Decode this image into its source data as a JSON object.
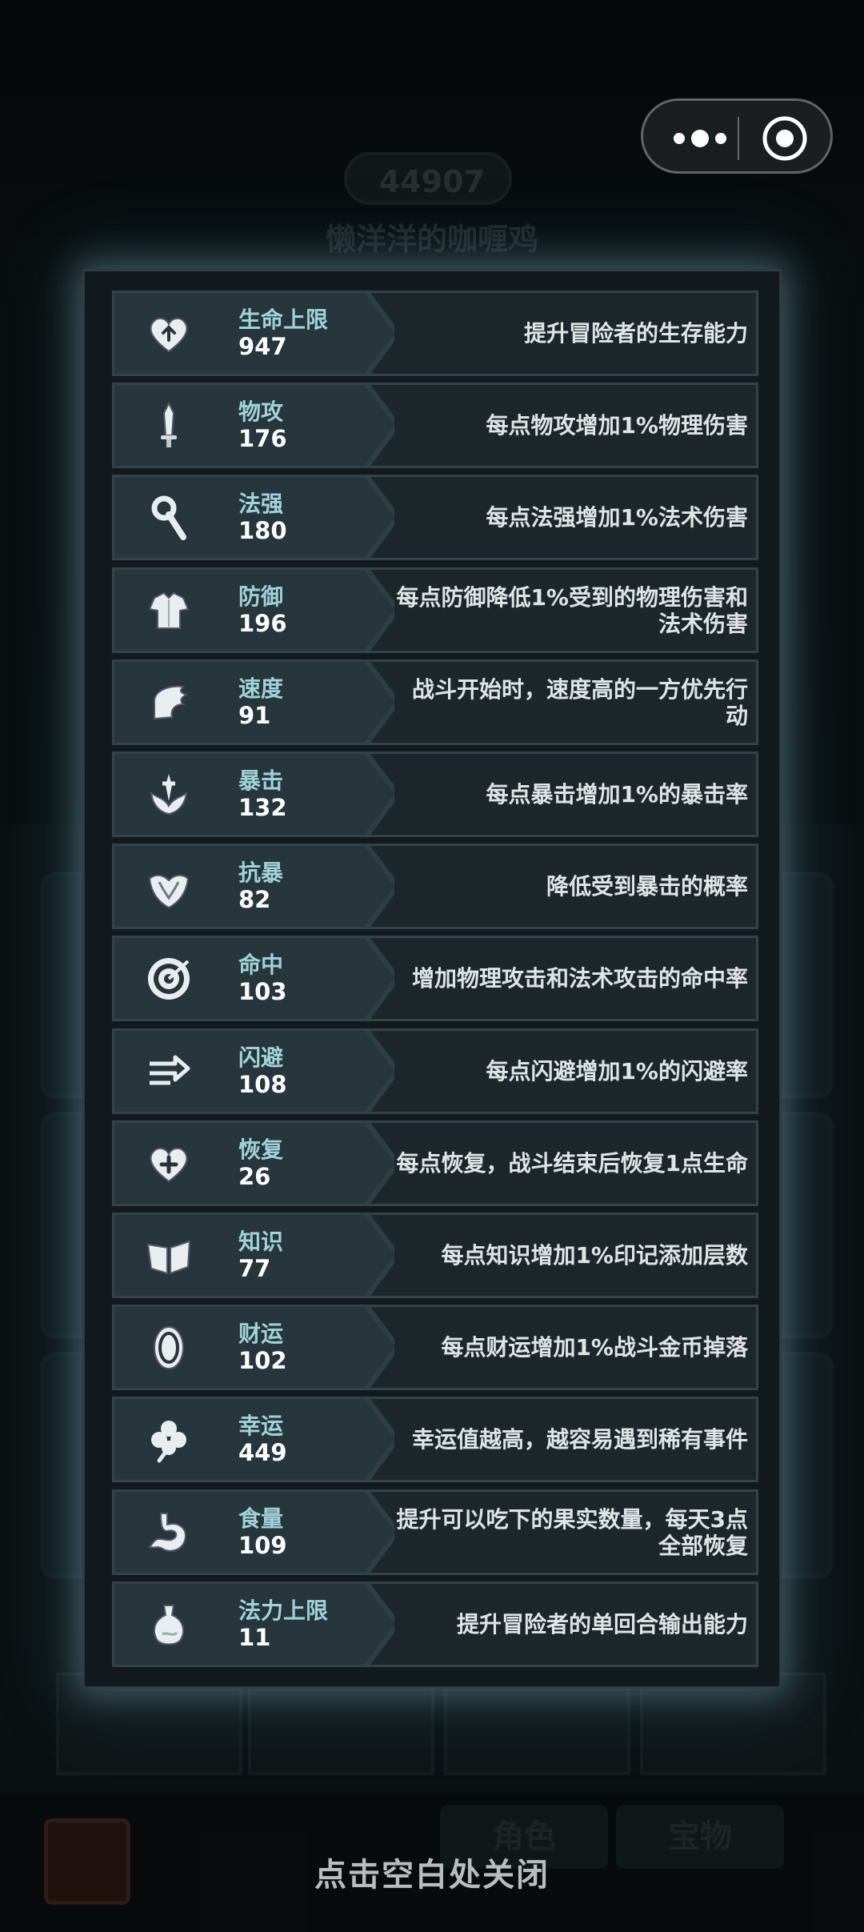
{
  "background": {
    "score": "44907",
    "player_name": "懒洋洋的咖喱鸡",
    "tab_role": "角色",
    "tab_treasure": "宝物"
  },
  "capsule": {
    "more_icon": "more-dots-icon",
    "close_icon": "target-close-icon"
  },
  "stats": [
    {
      "icon": "heart-up-icon",
      "name": "生命上限",
      "value": "947",
      "desc": "提升冒险者的生存能力"
    },
    {
      "icon": "sword-icon",
      "name": "物攻",
      "value": "176",
      "desc": "每点物攻增加1%物理伤害"
    },
    {
      "icon": "staff-icon",
      "name": "法强",
      "value": "180",
      "desc": "每点法强增加1%法术伤害"
    },
    {
      "icon": "armor-icon",
      "name": "防御",
      "value": "196",
      "desc": "每点防御降低1%受到的物理伤害和法术伤害"
    },
    {
      "icon": "wing-boot-icon",
      "name": "速度",
      "value": "91",
      "desc": "战斗开始时，速度高的一方优先行动"
    },
    {
      "icon": "crit-icon",
      "name": "暴击",
      "value": "132",
      "desc": "每点暴击增加1%的暴击率"
    },
    {
      "icon": "anti-crit-icon",
      "name": "抗暴",
      "value": "82",
      "desc": "降低受到暴击的概率"
    },
    {
      "icon": "target-icon",
      "name": "命中",
      "value": "103",
      "desc": "增加物理攻击和法术攻击的命中率"
    },
    {
      "icon": "dodge-arrows-icon",
      "name": "闪避",
      "value": "108",
      "desc": "每点闪避增加1%的闪避率"
    },
    {
      "icon": "heart-plus-icon",
      "name": "恢复",
      "value": "26",
      "desc": "每点恢复，战斗结束后恢复1点生命"
    },
    {
      "icon": "book-icon",
      "name": "知识",
      "value": "77",
      "desc": "每点知识增加1%印记添加层数"
    },
    {
      "icon": "coin-icon",
      "name": "财运",
      "value": "102",
      "desc": "每点财运增加1%战斗金币掉落"
    },
    {
      "icon": "clover-icon",
      "name": "幸运",
      "value": "449",
      "desc": "幸运值越高，越容易遇到稀有事件"
    },
    {
      "icon": "stomach-icon",
      "name": "食量",
      "value": "109",
      "desc": "提升可以吃下的果实数量，每天3点全部恢复"
    },
    {
      "icon": "mana-flask-icon",
      "name": "法力上限",
      "value": "11",
      "desc": "提升冒险者的单回合输出能力"
    }
  ],
  "close_hint": "点击空白处关闭"
}
